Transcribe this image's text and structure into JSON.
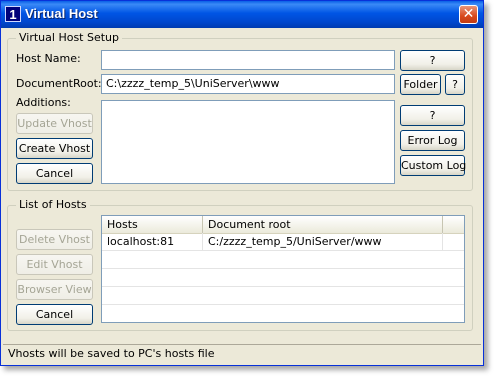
{
  "window": {
    "icon_glyph": "1",
    "title": "Virtual Host",
    "close_glyph": "✕"
  },
  "setup": {
    "group_title": "Virtual Host Setup",
    "host_name_label": "Host Name:",
    "host_name_value": "",
    "docroot_label": "DocumentRoot:",
    "docroot_value": "C:\\zzzz_temp_5\\UniServer\\www",
    "additions_label": "Additions:",
    "additions_value": "",
    "update_button": "Update Vhost",
    "create_button": "Create Vhost",
    "cancel_button": "Cancel",
    "host_help_button": "?",
    "folder_button": "Folder",
    "docroot_help_button": "?",
    "additions_help_button": "?",
    "error_log_button": "Error Log",
    "custom_log_button": "Custom Log"
  },
  "hosts": {
    "group_title": "List of Hosts",
    "delete_button": "Delete Vhost",
    "edit_button": "Edit Vhost",
    "browser_button": "Browser View",
    "cancel_button": "Cancel",
    "columns": [
      "Hosts",
      "Document root"
    ],
    "rows": [
      {
        "host": "localhost:81",
        "docroot": "C:/zzzz_temp_5/UniServer/www"
      }
    ]
  },
  "status": {
    "text": "Vhosts will be saved to PC's hosts file"
  }
}
